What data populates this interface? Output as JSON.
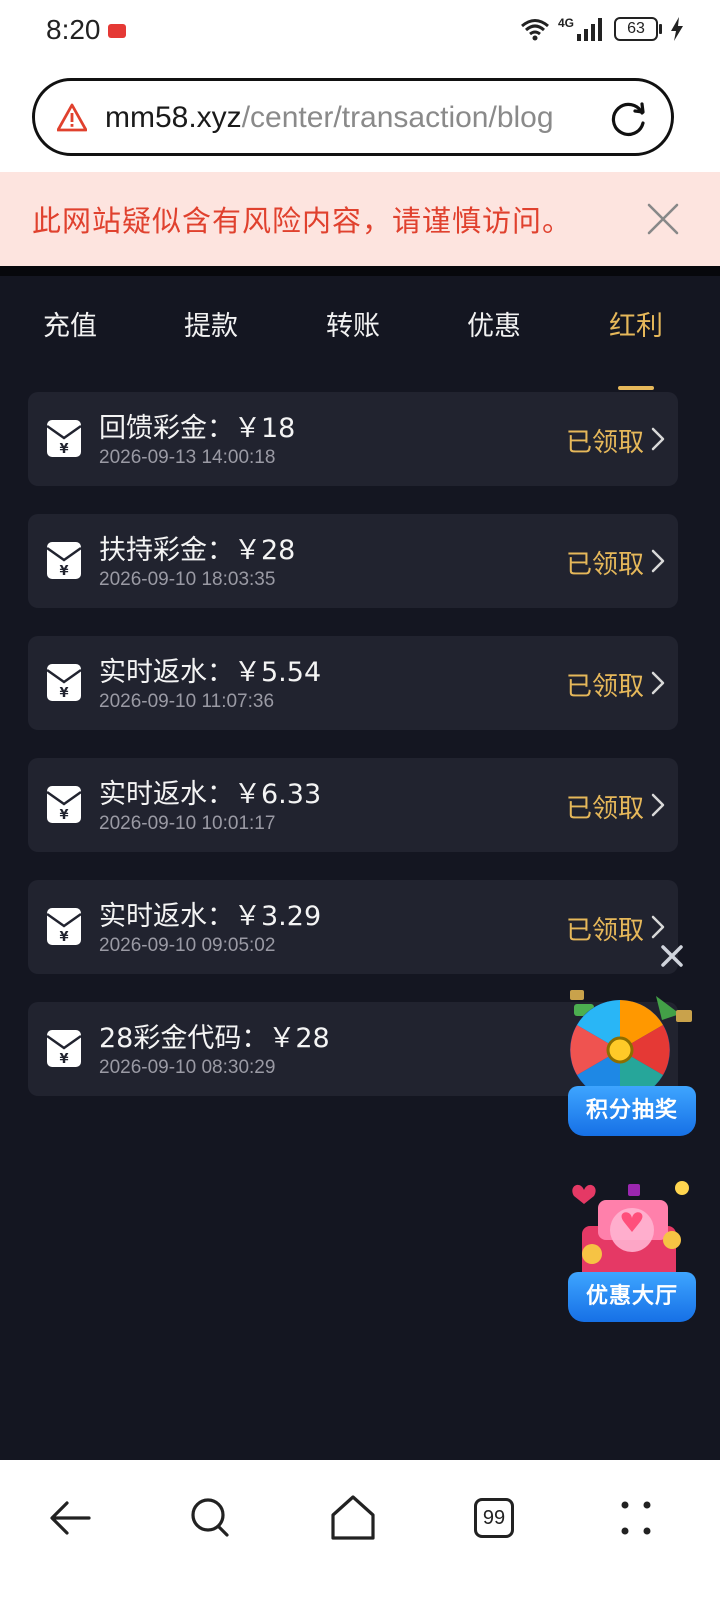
{
  "status_bar": {
    "time": "8:20",
    "network": "4G",
    "battery": "63"
  },
  "url_bar": {
    "domain": "mm58.xyz",
    "path": "/center/transaction/blog",
    "warning_icon": "warning-triangle-icon",
    "reload_icon": "reload-icon"
  },
  "warning": {
    "text": "此网站疑似含有风险内容，请谨慎访问。",
    "color": "#e0412e",
    "background": "#fde4df"
  },
  "tabs": [
    {
      "label": "充值",
      "active": false
    },
    {
      "label": "提款",
      "active": false
    },
    {
      "label": "转账",
      "active": false
    },
    {
      "label": "优惠",
      "active": false
    },
    {
      "label": "红利",
      "active": true
    }
  ],
  "records": [
    {
      "title": "回馈彩金：￥18",
      "time": "2026-09-13 14:00:18",
      "status": "已领取"
    },
    {
      "title": "扶持彩金：￥28",
      "time": "2026-09-10 18:03:35",
      "status": "已领取"
    },
    {
      "title": "实时返水：￥5.54",
      "time": "2026-09-10 11:07:36",
      "status": "已领取"
    },
    {
      "title": "实时返水：￥6.33",
      "time": "2026-09-10 10:01:17",
      "status": "已领取"
    },
    {
      "title": "实时返水：￥3.29",
      "time": "2026-09-10 09:05:02",
      "status": "已领取"
    },
    {
      "title": "28彩金代码：￥28",
      "time": "2026-09-10 08:30:29",
      "status": ""
    }
  ],
  "widgets": {
    "lottery_label": "积分抽奖",
    "promo_label": "优惠大厅"
  },
  "bottom_nav": {
    "tab_count": "99",
    "icons": [
      "back-arrow-icon",
      "search-icon",
      "home-icon",
      "tabs-icon",
      "menu-dots-icon"
    ]
  },
  "colors": {
    "accent": "#e6b85a",
    "app_bg": "#141621",
    "card_bg": "#21232f",
    "widget_blue": "#1670e6"
  }
}
